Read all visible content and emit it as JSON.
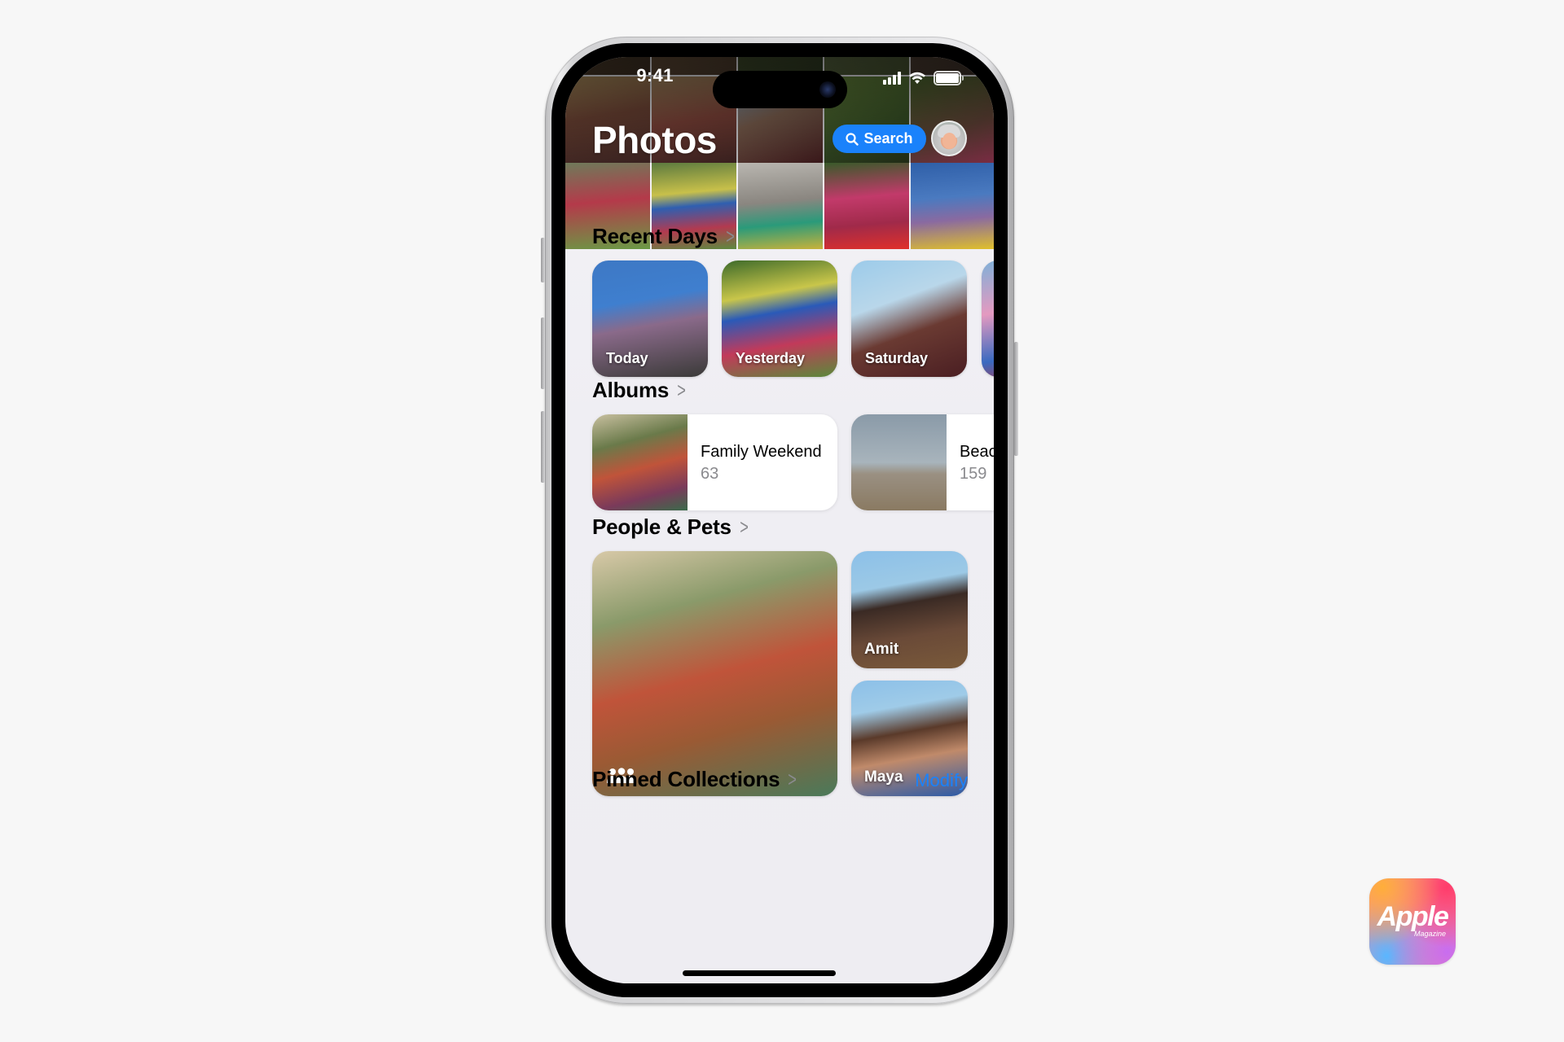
{
  "status_bar": {
    "time": "9:41",
    "icons": [
      "cellular-signal-icon",
      "wifi-icon",
      "battery-icon"
    ],
    "battery_level": 1.0
  },
  "header": {
    "title": "Photos",
    "search_label": "Search",
    "search_icon": "magnifying-glass-icon",
    "avatar": "memoji-avatar"
  },
  "sections": {
    "recent_days": {
      "title": "Recent Days",
      "items": [
        {
          "label": "Today"
        },
        {
          "label": "Yesterday"
        },
        {
          "label": "Saturday"
        },
        {
          "label": ""
        }
      ]
    },
    "albums": {
      "title": "Albums",
      "items": [
        {
          "name": "Family Weekend",
          "count": "63"
        },
        {
          "name": "Beac",
          "count": "159"
        }
      ]
    },
    "people_pets": {
      "title": "People & Pets",
      "group_icon": "people-group-icon",
      "items": [
        {
          "label": "Amit"
        },
        {
          "label": "Maya"
        }
      ]
    },
    "pinned_collections": {
      "title": "Pinned Collections",
      "action_label": "Modify"
    }
  },
  "watermark": {
    "word": "Apple",
    "sub": "Magazine"
  },
  "colors": {
    "accent": "#1a82fb",
    "screen_bg": "#efeef3",
    "secondary_text": "#8a8a8e"
  }
}
